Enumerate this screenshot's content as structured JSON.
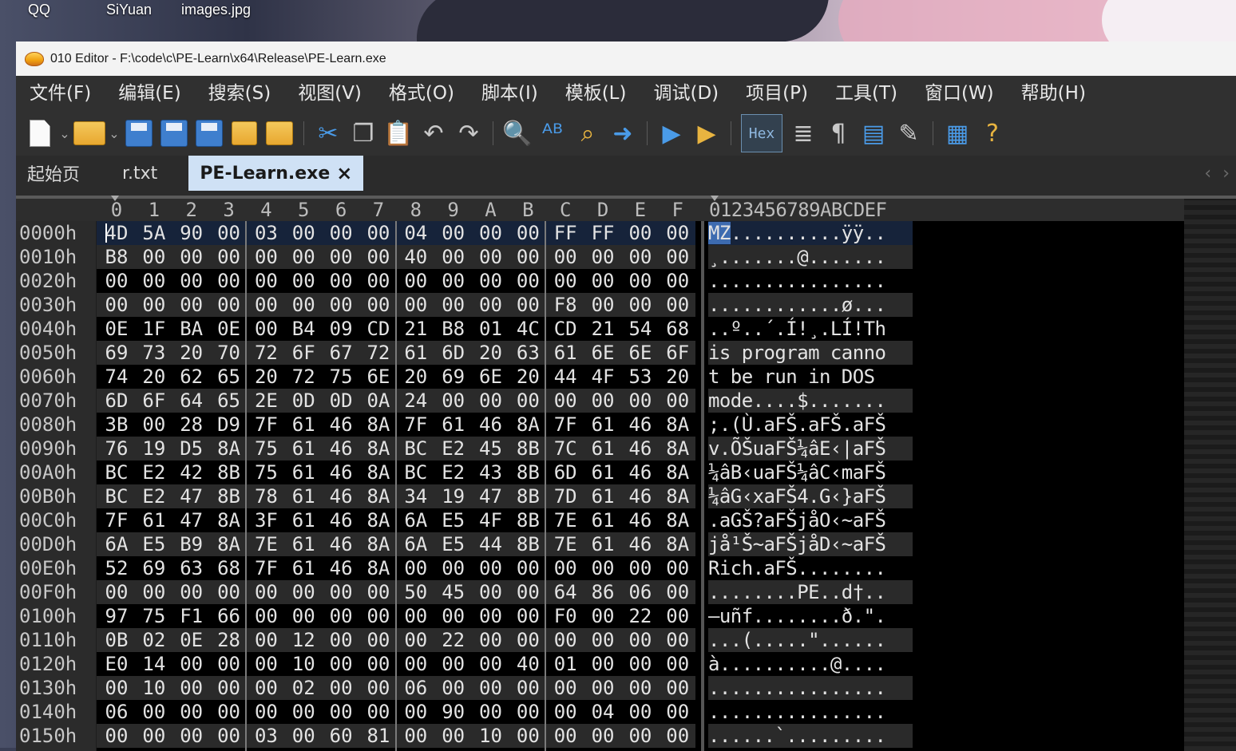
{
  "desktop": {
    "icons": [
      "QQ",
      "SiYuan",
      "images.jpg"
    ]
  },
  "window": {
    "title": "010 Editor - F:\\code\\c\\PE-Learn\\x64\\Release\\PE-Learn.exe"
  },
  "menu": [
    "文件(F)",
    "编辑(E)",
    "搜索(S)",
    "视图(V)",
    "格式(O)",
    "脚本(I)",
    "模板(L)",
    "调试(D)",
    "项目(P)",
    "工具(T)",
    "窗口(W)",
    "帮助(H)"
  ],
  "toolbar": {
    "hex_label": "Hex"
  },
  "tabs": [
    {
      "label": "起始页",
      "active": false
    },
    {
      "label": "r.txt",
      "active": false
    },
    {
      "label": "PE-Learn.exe",
      "active": true
    }
  ],
  "editor": {
    "columns": [
      "0",
      "1",
      "2",
      "3",
      "4",
      "5",
      "6",
      "7",
      "8",
      "9",
      "A",
      "B",
      "C",
      "D",
      "E",
      "F"
    ],
    "ascii_header": "0123456789ABCDEF",
    "rows": [
      {
        "addr": "0000h",
        "bytes": [
          "4D",
          "5A",
          "90",
          "00",
          "03",
          "00",
          "00",
          "00",
          "04",
          "00",
          "00",
          "00",
          "FF",
          "FF",
          "00",
          "00"
        ],
        "ascii": "MZ..........ÿÿ.."
      },
      {
        "addr": "0010h",
        "bytes": [
          "B8",
          "00",
          "00",
          "00",
          "00",
          "00",
          "00",
          "00",
          "40",
          "00",
          "00",
          "00",
          "00",
          "00",
          "00",
          "00"
        ],
        "ascii": "¸.......@......."
      },
      {
        "addr": "0020h",
        "bytes": [
          "00",
          "00",
          "00",
          "00",
          "00",
          "00",
          "00",
          "00",
          "00",
          "00",
          "00",
          "00",
          "00",
          "00",
          "00",
          "00"
        ],
        "ascii": "................"
      },
      {
        "addr": "0030h",
        "bytes": [
          "00",
          "00",
          "00",
          "00",
          "00",
          "00",
          "00",
          "00",
          "00",
          "00",
          "00",
          "00",
          "F8",
          "00",
          "00",
          "00"
        ],
        "ascii": "............ø..."
      },
      {
        "addr": "0040h",
        "bytes": [
          "0E",
          "1F",
          "BA",
          "0E",
          "00",
          "B4",
          "09",
          "CD",
          "21",
          "B8",
          "01",
          "4C",
          "CD",
          "21",
          "54",
          "68"
        ],
        "ascii": "..º..´.Í!¸.LÍ!Th"
      },
      {
        "addr": "0050h",
        "bytes": [
          "69",
          "73",
          "20",
          "70",
          "72",
          "6F",
          "67",
          "72",
          "61",
          "6D",
          "20",
          "63",
          "61",
          "6E",
          "6E",
          "6F"
        ],
        "ascii": "is program canno"
      },
      {
        "addr": "0060h",
        "bytes": [
          "74",
          "20",
          "62",
          "65",
          "20",
          "72",
          "75",
          "6E",
          "20",
          "69",
          "6E",
          "20",
          "44",
          "4F",
          "53",
          "20"
        ],
        "ascii": "t be run in DOS "
      },
      {
        "addr": "0070h",
        "bytes": [
          "6D",
          "6F",
          "64",
          "65",
          "2E",
          "0D",
          "0D",
          "0A",
          "24",
          "00",
          "00",
          "00",
          "00",
          "00",
          "00",
          "00"
        ],
        "ascii": "mode....$......."
      },
      {
        "addr": "0080h",
        "bytes": [
          "3B",
          "00",
          "28",
          "D9",
          "7F",
          "61",
          "46",
          "8A",
          "7F",
          "61",
          "46",
          "8A",
          "7F",
          "61",
          "46",
          "8A"
        ],
        "ascii": ";.(Ù.aFŠ.aFŠ.aFŠ"
      },
      {
        "addr": "0090h",
        "bytes": [
          "76",
          "19",
          "D5",
          "8A",
          "75",
          "61",
          "46",
          "8A",
          "BC",
          "E2",
          "45",
          "8B",
          "7C",
          "61",
          "46",
          "8A"
        ],
        "ascii": "v.ÕŠuaFŠ¼âE‹|aFŠ"
      },
      {
        "addr": "00A0h",
        "bytes": [
          "BC",
          "E2",
          "42",
          "8B",
          "75",
          "61",
          "46",
          "8A",
          "BC",
          "E2",
          "43",
          "8B",
          "6D",
          "61",
          "46",
          "8A"
        ],
        "ascii": "¼âB‹uaFŠ¼âC‹maFŠ"
      },
      {
        "addr": "00B0h",
        "bytes": [
          "BC",
          "E2",
          "47",
          "8B",
          "78",
          "61",
          "46",
          "8A",
          "34",
          "19",
          "47",
          "8B",
          "7D",
          "61",
          "46",
          "8A"
        ],
        "ascii": "¼âG‹xaFŠ4.G‹}aFŠ"
      },
      {
        "addr": "00C0h",
        "bytes": [
          "7F",
          "61",
          "47",
          "8A",
          "3F",
          "61",
          "46",
          "8A",
          "6A",
          "E5",
          "4F",
          "8B",
          "7E",
          "61",
          "46",
          "8A"
        ],
        "ascii": ".aGŠ?aFŠjåO‹~aFŠ"
      },
      {
        "addr": "00D0h",
        "bytes": [
          "6A",
          "E5",
          "B9",
          "8A",
          "7E",
          "61",
          "46",
          "8A",
          "6A",
          "E5",
          "44",
          "8B",
          "7E",
          "61",
          "46",
          "8A"
        ],
        "ascii": "jå¹Š~aFŠjåD‹~aFŠ"
      },
      {
        "addr": "00E0h",
        "bytes": [
          "52",
          "69",
          "63",
          "68",
          "7F",
          "61",
          "46",
          "8A",
          "00",
          "00",
          "00",
          "00",
          "00",
          "00",
          "00",
          "00"
        ],
        "ascii": "Rich.aFŠ........"
      },
      {
        "addr": "00F0h",
        "bytes": [
          "00",
          "00",
          "00",
          "00",
          "00",
          "00",
          "00",
          "00",
          "50",
          "45",
          "00",
          "00",
          "64",
          "86",
          "06",
          "00"
        ],
        "ascii": "........PE..d†.."
      },
      {
        "addr": "0100h",
        "bytes": [
          "97",
          "75",
          "F1",
          "66",
          "00",
          "00",
          "00",
          "00",
          "00",
          "00",
          "00",
          "00",
          "F0",
          "00",
          "22",
          "00"
        ],
        "ascii": "—uñf........ð.\"."
      },
      {
        "addr": "0110h",
        "bytes": [
          "0B",
          "02",
          "0E",
          "28",
          "00",
          "12",
          "00",
          "00",
          "00",
          "22",
          "00",
          "00",
          "00",
          "00",
          "00",
          "00"
        ],
        "ascii": "...(.....\"......"
      },
      {
        "addr": "0120h",
        "bytes": [
          "E0",
          "14",
          "00",
          "00",
          "00",
          "10",
          "00",
          "00",
          "00",
          "00",
          "00",
          "40",
          "01",
          "00",
          "00",
          "00"
        ],
        "ascii": "à..........@...."
      },
      {
        "addr": "0130h",
        "bytes": [
          "00",
          "10",
          "00",
          "00",
          "00",
          "02",
          "00",
          "00",
          "06",
          "00",
          "00",
          "00",
          "00",
          "00",
          "00",
          "00"
        ],
        "ascii": "................"
      },
      {
        "addr": "0140h",
        "bytes": [
          "06",
          "00",
          "00",
          "00",
          "00",
          "00",
          "00",
          "00",
          "00",
          "90",
          "00",
          "00",
          "00",
          "04",
          "00",
          "00"
        ],
        "ascii": "................"
      },
      {
        "addr": "0150h",
        "bytes": [
          "00",
          "00",
          "00",
          "00",
          "03",
          "00",
          "60",
          "81",
          "00",
          "00",
          "10",
          "00",
          "00",
          "00",
          "00",
          "00"
        ],
        "ascii": "......`........."
      }
    ]
  }
}
